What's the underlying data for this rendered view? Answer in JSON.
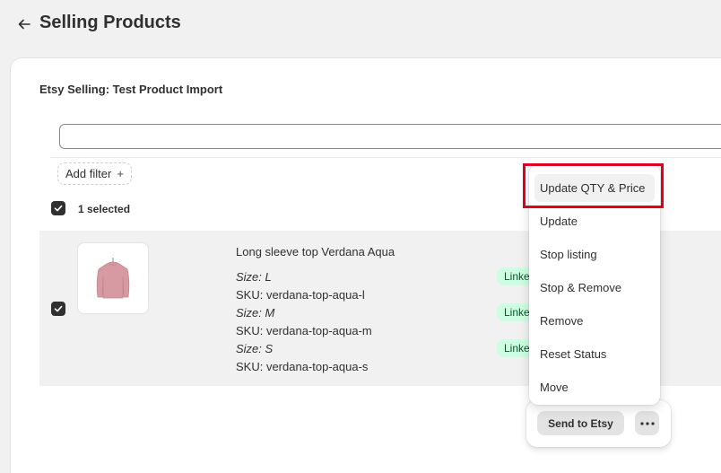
{
  "header": {
    "title": "Selling Products",
    "back_icon": "arrow-left-icon"
  },
  "card": {
    "title": "Etsy Selling: Test Product Import"
  },
  "search": {
    "value": "",
    "placeholder": ""
  },
  "filter": {
    "add_label": "Add filter",
    "plus_icon": "+"
  },
  "selection": {
    "count_label": "1 selected"
  },
  "product": {
    "name": "Long sleeve top Verdana Aqua",
    "variants": [
      {
        "size_label": "Size:",
        "size": "L",
        "sku": "SKU: verdana-top-aqua-l",
        "status": "Linked"
      },
      {
        "size_label": "Size:",
        "size": "M",
        "sku": "SKU: verdana-top-aqua-m",
        "status": "Linked"
      },
      {
        "size_label": "Size:",
        "size": "S",
        "sku": "SKU: verdana-top-aqua-s",
        "status": "Linked"
      }
    ]
  },
  "menu": {
    "items": [
      {
        "label": "Update QTY & Price",
        "active": true
      },
      {
        "label": "Update"
      },
      {
        "label": "Stop listing"
      },
      {
        "label": "Stop & Remove"
      },
      {
        "label": "Remove"
      },
      {
        "label": "Reset Status"
      },
      {
        "label": "Move"
      }
    ]
  },
  "actions": {
    "send_label": "Send to Etsy",
    "more_icon": "ellipsis-icon"
  },
  "colors": {
    "highlight": "#e0001b",
    "badge_bg": "#cdfee1",
    "badge_text": "#0c5132",
    "checkbox": "#303030"
  }
}
